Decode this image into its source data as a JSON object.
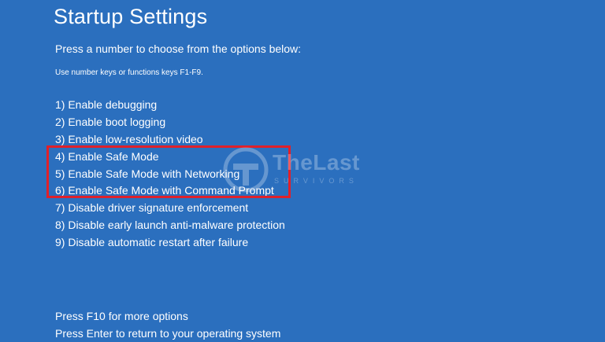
{
  "screen": {
    "title": "Startup Settings",
    "prompt": "Press a number to choose from the options below:",
    "hint": "Use number keys or functions keys F1-F9."
  },
  "options": [
    {
      "label": "1) Enable debugging"
    },
    {
      "label": "2) Enable boot logging"
    },
    {
      "label": "3) Enable low-resolution video"
    },
    {
      "label": "4) Enable Safe Mode"
    },
    {
      "label": "5) Enable Safe Mode with Networking"
    },
    {
      "label": "6) Enable Safe Mode with Command Prompt"
    },
    {
      "label": "7) Disable driver signature enforcement"
    },
    {
      "label": "8) Disable early launch anti-malware protection"
    },
    {
      "label": "9) Disable automatic restart after failure"
    }
  ],
  "footer": {
    "more_options": "Press F10 for more options",
    "return": "Press Enter to return to your operating system"
  },
  "watermark": {
    "brand": "TheLast",
    "sub": "SURVIVORS"
  },
  "colors": {
    "background": "#2b6fbe",
    "text": "#ffffff",
    "highlight_border": "#e0202a"
  }
}
